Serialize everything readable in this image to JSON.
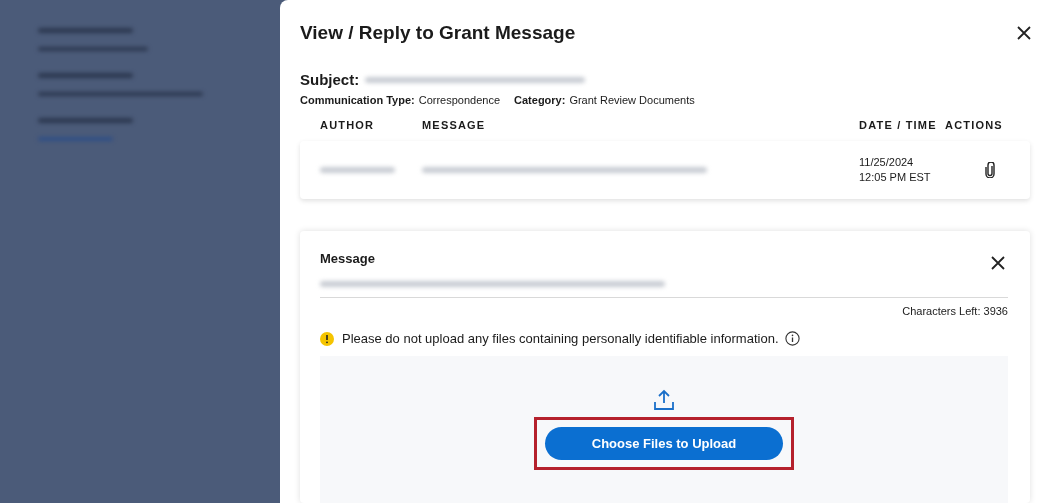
{
  "dialog": {
    "title": "View / Reply to Grant Message",
    "subject_label": "Subject:",
    "communication_type_label": "Communication Type:",
    "communication_type": "Correspondence",
    "category_label": "Category:",
    "category": "Grant Review Documents"
  },
  "table": {
    "columns": [
      "AUTHOR",
      "MESSAGE",
      "DATE / TIME",
      "ACTIONS"
    ],
    "rows": [
      {
        "date": "11/25/2024",
        "time": "12:05 PM EST"
      }
    ]
  },
  "reply": {
    "label": "Message",
    "characters_left": "Characters Left: 3936",
    "warning": "Please do not upload any files containing personally identifiable information.",
    "upload_button": {
      "label": "Choose Files to Upload",
      "highlighted": true
    }
  }
}
